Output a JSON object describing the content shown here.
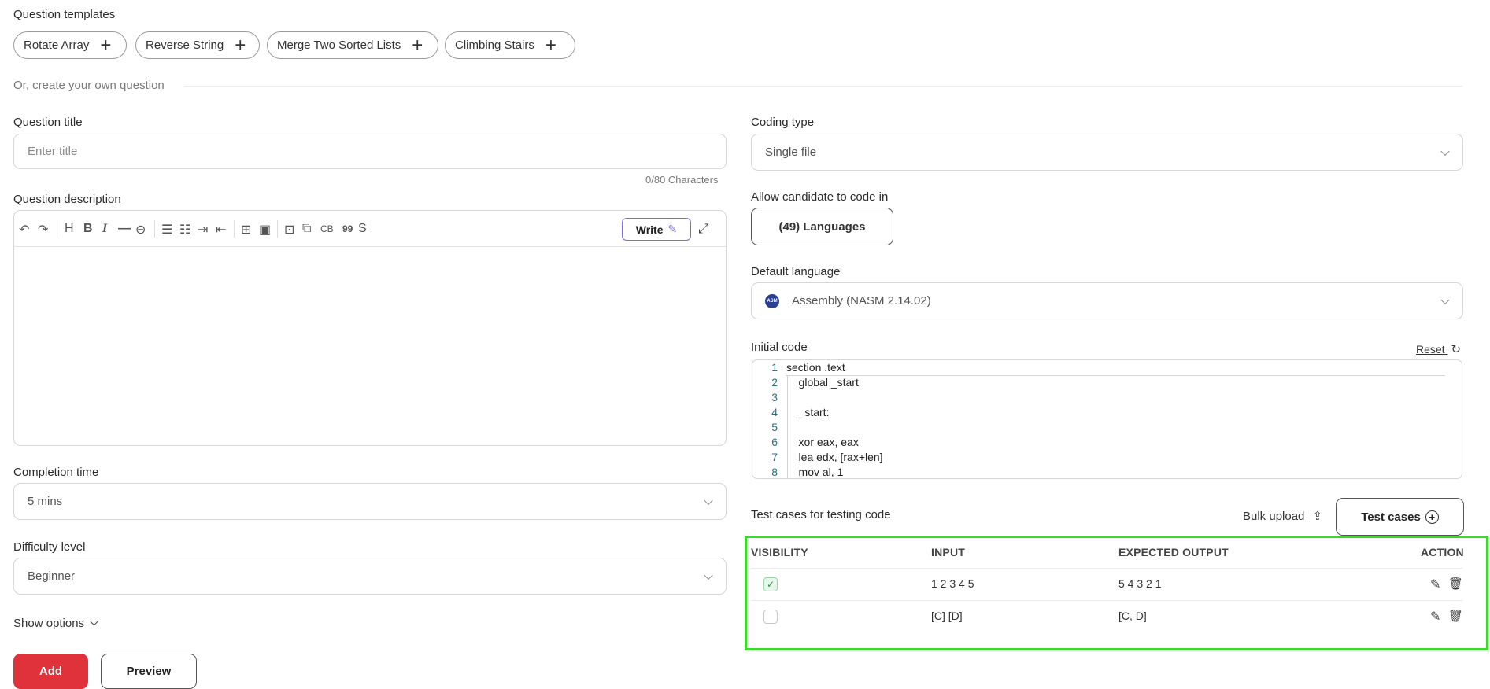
{
  "templates": {
    "heading": "Question templates",
    "chips": [
      "Rotate Array",
      "Reverse String",
      "Merge Two Sorted Lists",
      "Climbing Stairs"
    ],
    "divider_text": "Or, create your own question"
  },
  "left": {
    "title_label": "Question title",
    "title_placeholder": "Enter title",
    "char_count": "0/80 Characters",
    "description_label": "Question description",
    "toolbar": {
      "cb": "CB",
      "quote": "99",
      "write_button": "Write"
    },
    "completion_label": "Completion time",
    "completion_value": "5 mins",
    "difficulty_label": "Difficulty level",
    "difficulty_value": "Beginner",
    "show_options": "Show options",
    "add_button": "Add",
    "preview_button": "Preview"
  },
  "right": {
    "coding_type_label": "Coding type",
    "coding_type_value": "Single file",
    "allow_label": "Allow candidate to code in",
    "languages_button": "(49) Languages",
    "default_language_label": "Default language",
    "default_language_value": "Assembly (NASM 2.14.02)",
    "language_icon_text": "ASM",
    "initial_code_label": "Initial code",
    "reset_label": "Reset",
    "code_lines": [
      "section .text",
      "    global _start",
      "",
      "    _start:",
      "",
      "    xor eax, eax",
      "    lea edx, [rax+len]",
      "    mov al, 1"
    ],
    "line_numbers": [
      "1",
      "2",
      "3",
      "4",
      "5",
      "6",
      "7",
      "8"
    ],
    "test_cases_label": "Test cases for testing code",
    "bulk_upload": "Bulk upload",
    "test_cases_button": "Test cases",
    "table": {
      "headers": [
        "VISIBILITY",
        "INPUT",
        "EXPECTED OUTPUT",
        "ACTION"
      ],
      "rows": [
        {
          "visible": true,
          "input": "1 2 3 4 5",
          "output": "5 4 3 2 1"
        },
        {
          "visible": false,
          "input": "[C] [D]",
          "output": "[C, D]"
        }
      ]
    }
  },
  "colors": {
    "accent_red": "#e0323a",
    "highlight_green": "#3ad92a",
    "write_border": "#7b6ee0"
  }
}
